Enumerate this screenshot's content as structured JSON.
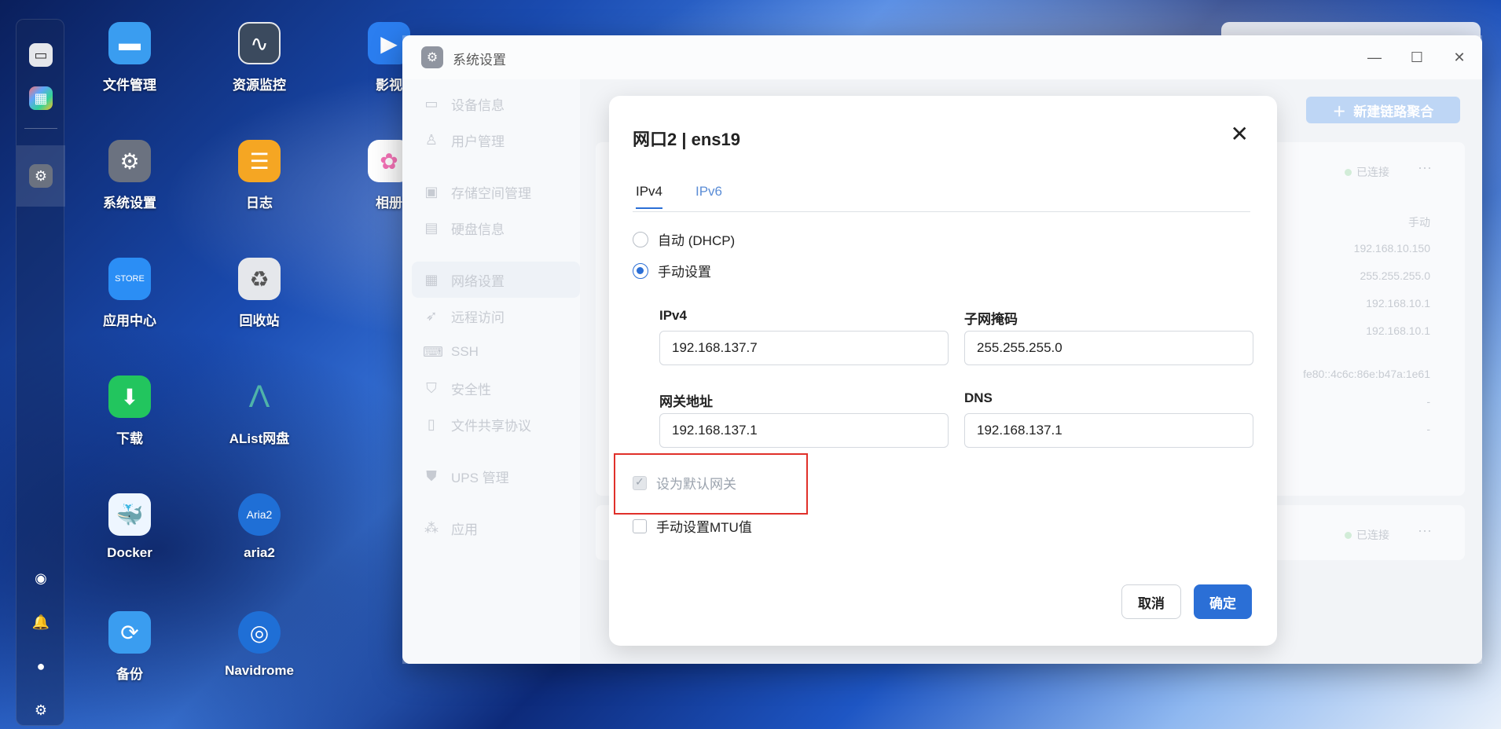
{
  "desktop": {
    "icons": [
      {
        "label": "文件管理",
        "icon": "folder-icon",
        "color": "#3a9df0"
      },
      {
        "label": "资源监控",
        "icon": "monitor-chart-icon",
        "color": "#3b4a5e"
      },
      {
        "label": "影视",
        "icon": "video-icon",
        "color": "#2b7ef0"
      },
      {
        "label": "系统设置",
        "icon": "gear-icon",
        "color": "#6b7280"
      },
      {
        "label": "日志",
        "icon": "log-icon",
        "color": "#f5a623"
      },
      {
        "label": "相册",
        "icon": "photos-icon",
        "color": "#ffffff"
      },
      {
        "label": "应用中心",
        "icon": "store-icon",
        "color": "#2b8ef5"
      },
      {
        "label": "回收站",
        "icon": "recycle-icon",
        "color": "#e5e7eb"
      },
      {
        "label": "下载",
        "icon": "download-icon",
        "color": "#22c55e"
      },
      {
        "label": "AList网盘",
        "icon": "alist-icon",
        "color": "#4fb3a9"
      },
      {
        "label": "Docker",
        "icon": "docker-icon",
        "color": "#eef6ff"
      },
      {
        "label": "aria2",
        "icon": "aria2-icon",
        "color": "#1f6fd6"
      },
      {
        "label": "备份",
        "icon": "backup-icon",
        "color": "#3a9df0"
      },
      {
        "label": "Navidrome",
        "icon": "navidrome-icon",
        "color": "#1f6fd6"
      }
    ]
  },
  "window": {
    "title": "系统设置",
    "sidebar": [
      {
        "label": "设备信息",
        "icon": "device-icon"
      },
      {
        "label": "用户管理",
        "icon": "user-manage-icon"
      },
      {
        "label": "存储空间管理",
        "icon": "storage-icon"
      },
      {
        "label": "硬盘信息",
        "icon": "disk-icon"
      },
      {
        "label": "网络设置",
        "icon": "network-icon",
        "active": true
      },
      {
        "label": "远程访问",
        "icon": "remote-icon"
      },
      {
        "label": "SSH",
        "icon": "ssh-icon"
      },
      {
        "label": "安全性",
        "icon": "shield-icon"
      },
      {
        "label": "文件共享协议",
        "icon": "file-share-icon"
      },
      {
        "label": "UPS 管理",
        "icon": "ups-icon"
      },
      {
        "label": "应用",
        "icon": "apps-icon"
      }
    ],
    "new_aggregation_button": "新建链路聚合",
    "background": {
      "status_connected": "已连接",
      "mode": "手动",
      "ip": "192.168.10.150",
      "mask": "255.255.255.0",
      "gateway": "192.168.10.1",
      "dns": "192.168.10.1",
      "ipv6": "fe80::4c6c:86e:b47a:1e61",
      "dash1": "-",
      "dash2": "-",
      "status_connected_2": "已连接"
    }
  },
  "modal": {
    "title": "网口2 | ens19",
    "tabs": [
      {
        "label": "IPv4",
        "active": true
      },
      {
        "label": "IPv6",
        "active": false
      }
    ],
    "modes": [
      {
        "label": "自动 (DHCP)",
        "checked": false
      },
      {
        "label": "手动设置",
        "checked": true
      }
    ],
    "fields": {
      "ipv4_label": "IPv4",
      "ipv4_value": "192.168.137.7",
      "mask_label": "子网掩码",
      "mask_value": "255.255.255.0",
      "gateway_label": "网关地址",
      "gateway_value": "192.168.137.1",
      "dns_label": "DNS",
      "dns_value": "192.168.137.1"
    },
    "default_gateway_label": "设为默认网关",
    "default_gateway_checked": true,
    "default_gateway_disabled": true,
    "mtu_label": "手动设置MTU值",
    "mtu_checked": false,
    "cancel_label": "取消",
    "ok_label": "确定"
  },
  "colors": {
    "accent": "#2b6fd6",
    "highlight": "#e0302a"
  }
}
